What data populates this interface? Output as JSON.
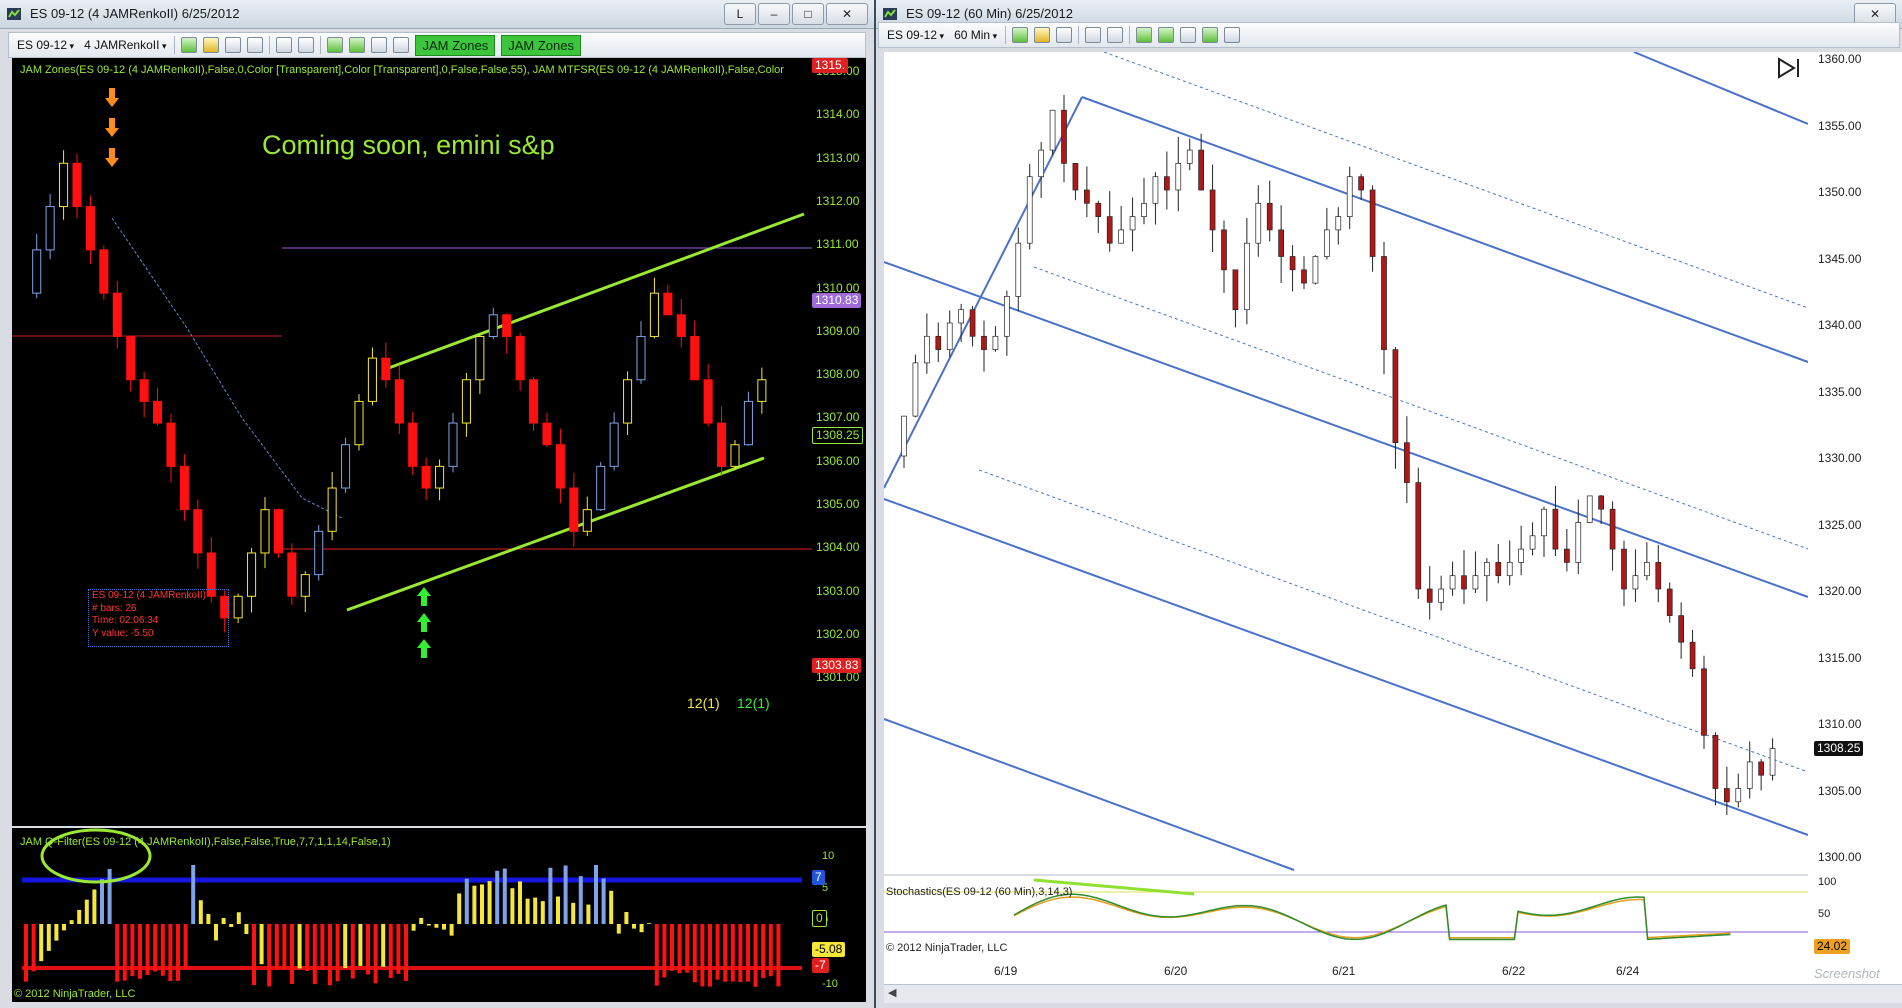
{
  "left_window": {
    "title": "ES 09-12 (4 JAMRenkoII)  6/25/2012",
    "controls": {
      "restore": "L",
      "minimize": "‒",
      "maximize": "□",
      "close": "✕"
    },
    "toolbar": {
      "instrument": "ES 09-12",
      "period": "4 JAMRenkoII",
      "buttons": [
        "JAM Zones",
        "JAM Zones"
      ]
    },
    "indicator_label": "JAM Zones(ES 09-12 (4 JAMRenkoII),False,0,Color [Transparent],Color [Transparent],0,False,False,55),  JAM MTFSR(ES 09-12 (4 JAMRenkoII),False,Color",
    "annotation": "Coming soon, emini s&p",
    "info_box": [
      "ES 09-12 (4 JAMRenkoII)",
      "# bars:   26",
      "Time:     02:06:34",
      "Y value:  -5.50"
    ],
    "counters": [
      "12(1)",
      "12(1)"
    ],
    "price_axis": [
      "1315.00",
      "1314.00",
      "1313.00",
      "1312.00",
      "1311.00",
      "1310.00",
      "1309.00",
      "1308.00",
      "1307.00",
      "1306.00",
      "1305.00",
      "1304.00",
      "1303.00",
      "1302.00",
      "1301.00"
    ],
    "price_markers": {
      "top": "1315.",
      "upper": "1310.83",
      "last": "1308.25",
      "lower": "1303.83"
    },
    "lower_panel": {
      "label": "JAM Q-Filter(ES 09-12 (4 JAMRenkoII),False,False,True,7,7,1,1,14,False,1)",
      "axis": [
        "10",
        "5",
        "0",
        "-5",
        "-10"
      ],
      "markers": {
        "upper": "7",
        "zero": "0",
        "value": "-5.08",
        "lower": "-7"
      },
      "copyright": "© 2012 NinjaTrader, LLC"
    },
    "colors": {
      "up": "#f5e63a",
      "down": "#ff1111",
      "blue": "#7fa3e8",
      "trend": "#9be834",
      "arrow_down": "#ff8c1a",
      "arrow_up": "#33ee33"
    }
  },
  "right_window": {
    "title": "ES 09-12 (60 Min)  6/25/2012",
    "controls": {
      "close": "✕"
    },
    "toolbar": {
      "instrument": "ES 09-12",
      "period": "60 Min"
    },
    "price_axis": [
      "1360.00",
      "1355.00",
      "1350.00",
      "1345.00",
      "1340.00",
      "1335.00",
      "1330.00",
      "1325.00",
      "1320.00",
      "1315.00",
      "1310.00",
      "1305.00",
      "1300.00"
    ],
    "last_price": "1308.25",
    "stochastics": {
      "label": "Stochastics(ES 09-12 (60 Min),3,14,3)",
      "axis": [
        "100",
        "50",
        "0"
      ],
      "value": "24.02"
    },
    "copyright": "© 2012 NinjaTrader, LLC",
    "dates": [
      "6/19",
      "6/20",
      "6/21",
      "6/22",
      "6/24"
    ],
    "watermark": "Screenshot",
    "colors": {
      "channel": "#4a72c8",
      "candle_up": "#ffffff",
      "candle_down": "#b01818",
      "stoch_k": "#2e8b2e",
      "stoch_d": "#e0a020"
    }
  }
}
